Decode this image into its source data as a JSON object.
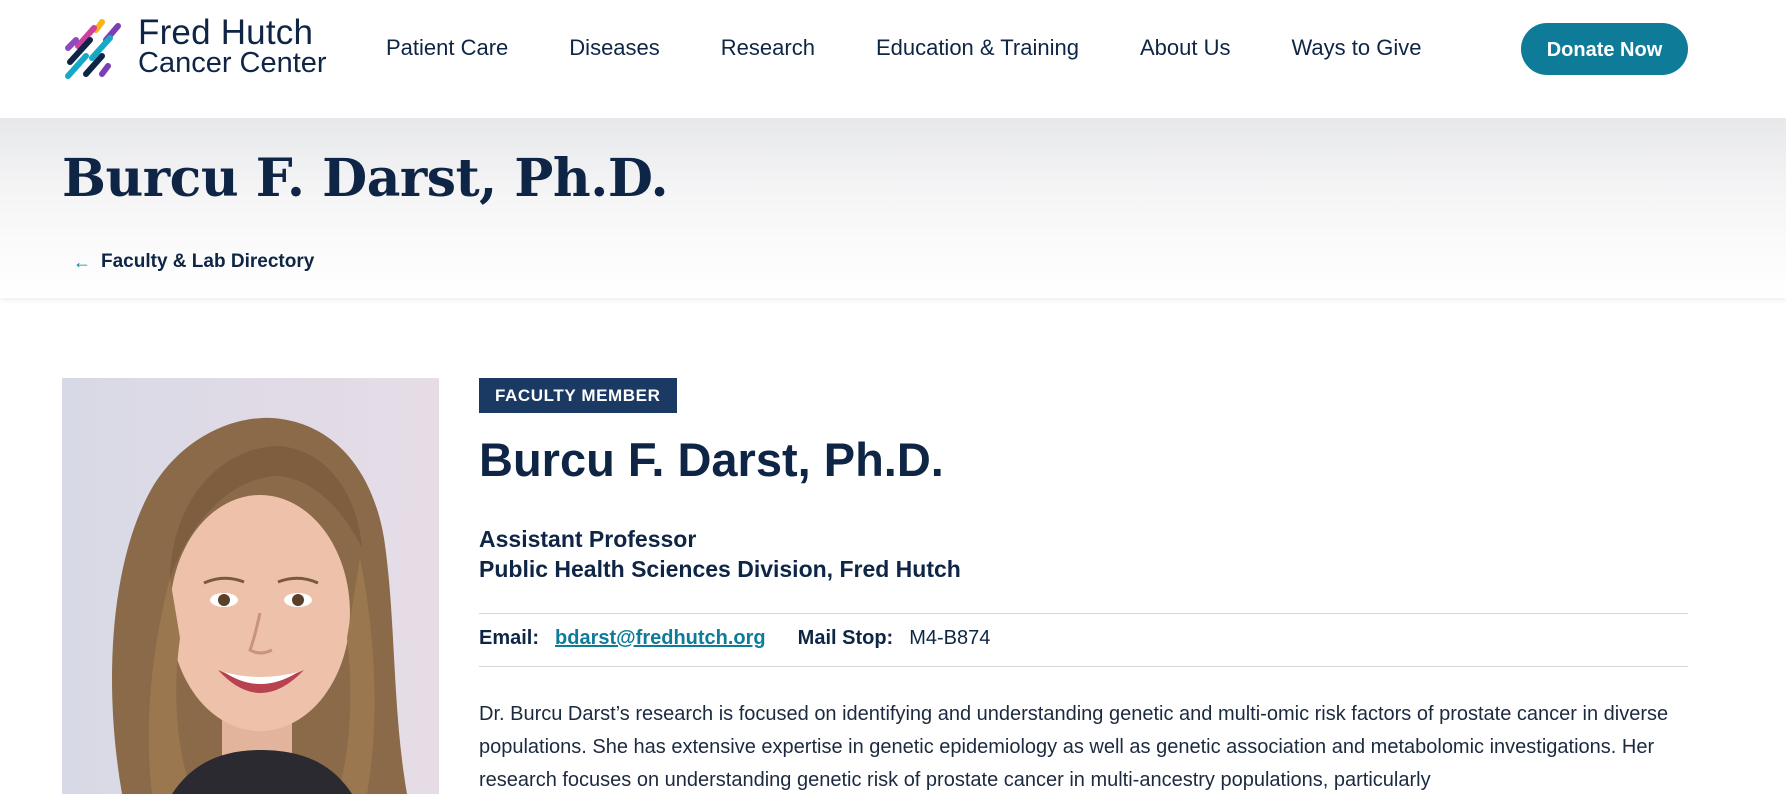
{
  "logo": {
    "line1": "Fred Hutch",
    "line2": "Cancer Center"
  },
  "nav": {
    "items": [
      "Patient Care",
      "Diseases",
      "Research",
      "Education & Training",
      "About Us",
      "Ways to Give"
    ],
    "donate_label": "Donate Now"
  },
  "banner": {
    "title": "Burcu F. Darst, Ph.D.",
    "back_label": "Faculty & Lab Directory"
  },
  "profile": {
    "badge": "FACULTY MEMBER",
    "name": "Burcu F. Darst, Ph.D.",
    "title": "Assistant Professor",
    "division": "Public Health Sciences Division, Fred Hutch",
    "email_label": "Email:",
    "email": "bdarst@fredhutch.org",
    "mailstop_label": "Mail Stop:",
    "mailstop": "M4-B874",
    "bio": "Dr. Burcu Darst’s research is focused on identifying and understanding genetic and multi-omic risk factors of prostate cancer in diverse populations. She has extensive expertise in genetic epidemiology as well as genetic association and metabolomic investigations. Her research focuses on understanding genetic risk of prostate cancer in multi-ancestry populations, particularly"
  },
  "colors": {
    "navy": "#0f2545",
    "teal": "#0e7c99",
    "badge": "#1b3a63"
  }
}
